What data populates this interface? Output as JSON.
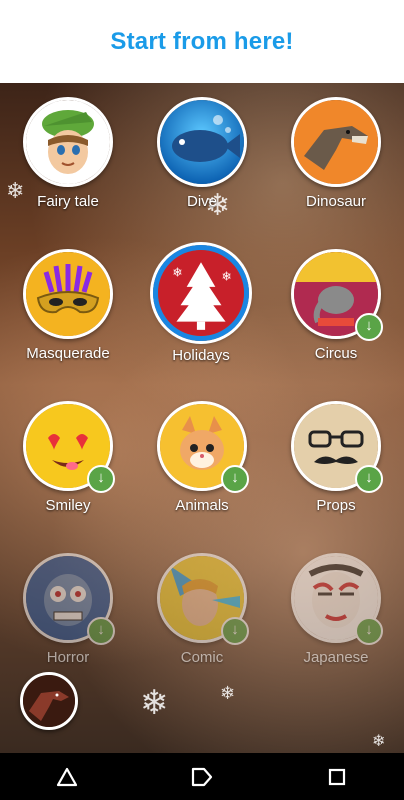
{
  "header": {
    "title": "Start from here!"
  },
  "colors": {
    "accent": "#1a9be8",
    "selected_ring": "#1a86e2",
    "download_badge": "#5aa447"
  },
  "items": [
    {
      "label": "Fairy tale",
      "icon": "elf-face-icon",
      "download": false,
      "selected": false
    },
    {
      "label": "Dive",
      "icon": "fish-icon",
      "download": false,
      "selected": false
    },
    {
      "label": "Dinosaur",
      "icon": "dinosaur-icon",
      "download": false,
      "selected": false
    },
    {
      "label": "Masquerade",
      "icon": "mask-icon",
      "download": false,
      "selected": false
    },
    {
      "label": "Holidays",
      "icon": "christmas-tree-icon",
      "download": false,
      "selected": true
    },
    {
      "label": "Circus",
      "icon": "circus-elephant-icon",
      "download": true,
      "selected": false
    },
    {
      "label": "Smiley",
      "icon": "heart-eyes-emoji-icon",
      "download": true,
      "selected": false
    },
    {
      "label": "Animals",
      "icon": "cat-face-icon",
      "download": true,
      "selected": false
    },
    {
      "label": "Props",
      "icon": "glasses-mustache-icon",
      "download": true,
      "selected": false
    },
    {
      "label": "Horror",
      "icon": "zombie-face-icon",
      "download": true,
      "selected": false
    },
    {
      "label": "Comic",
      "icon": "comic-hero-icon",
      "download": true,
      "selected": false
    },
    {
      "label": "Japanese",
      "icon": "kabuki-mask-icon",
      "download": true,
      "selected": false
    }
  ],
  "current_effect_icon": "dinosaur-icon",
  "navbar": {
    "back_icon": "back-triangle-icon",
    "home_icon": "home-icon",
    "recents_icon": "recents-square-icon"
  }
}
